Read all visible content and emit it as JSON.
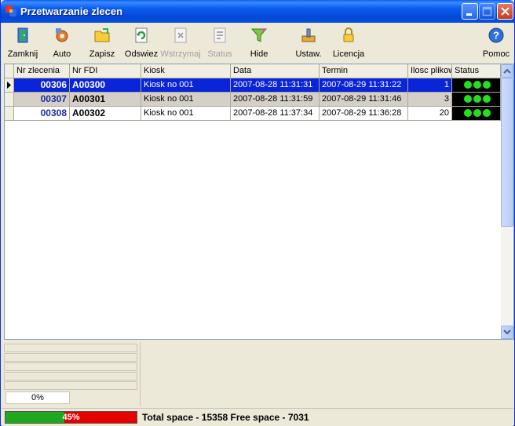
{
  "window": {
    "title": "Przetwarzanie zlecen"
  },
  "toolbar": {
    "items": [
      {
        "label": "Zamknij",
        "icon": "door-exit-icon",
        "enabled": true
      },
      {
        "label": "Auto",
        "icon": "gear-icon",
        "enabled": true
      },
      {
        "label": "Zapisz",
        "icon": "save-folder-icon",
        "enabled": true
      },
      {
        "label": "Odswiez",
        "icon": "refresh-icon",
        "enabled": true
      },
      {
        "label": "Wstrzymaj",
        "icon": "stop-icon",
        "enabled": false
      },
      {
        "label": "Status",
        "icon": "status-icon",
        "enabled": false
      },
      {
        "label": "Hide",
        "icon": "filter-icon",
        "enabled": true
      },
      {
        "label": "Ustaw.",
        "icon": "settings-icon",
        "enabled": true
      },
      {
        "label": "Licencja",
        "icon": "lock-icon",
        "enabled": true
      },
      {
        "label": "Pomoc",
        "icon": "help-icon",
        "enabled": true
      }
    ]
  },
  "grid": {
    "columns": [
      "Nr zlecenia",
      "Nr FDI",
      "Kiosk",
      "Data",
      "Termin",
      "Ilosc plikow",
      "Status"
    ],
    "rows": [
      {
        "nr": "00306",
        "fdi": "A00300",
        "kiosk": "Kiosk no 001",
        "data": "2007-08-28 11:31:31",
        "termin": "2007-08-29 11:31:22",
        "ilosc": "1",
        "selected": true
      },
      {
        "nr": "00307",
        "fdi": "A00301",
        "kiosk": "Kiosk no 001",
        "data": "2007-08-28 11:31:59",
        "termin": "2007-08-29 11:31:46",
        "ilosc": "3",
        "selected": false
      },
      {
        "nr": "00308",
        "fdi": "A00302",
        "kiosk": "Kiosk no 001",
        "data": "2007-08-28 11:37:34",
        "termin": "2007-08-29 11:36:28",
        "ilosc": "20",
        "selected": false
      }
    ]
  },
  "progress": {
    "text": "0%",
    "value": 0
  },
  "disk": {
    "used_percent": 45,
    "label": "45%",
    "summary": "Total space - 15358 Free space - 7031"
  },
  "colors": {
    "selection": "#0A24D8",
    "status_ok": "#22E01E",
    "disk_used": "#1FA81F",
    "disk_free": "#E60000"
  }
}
